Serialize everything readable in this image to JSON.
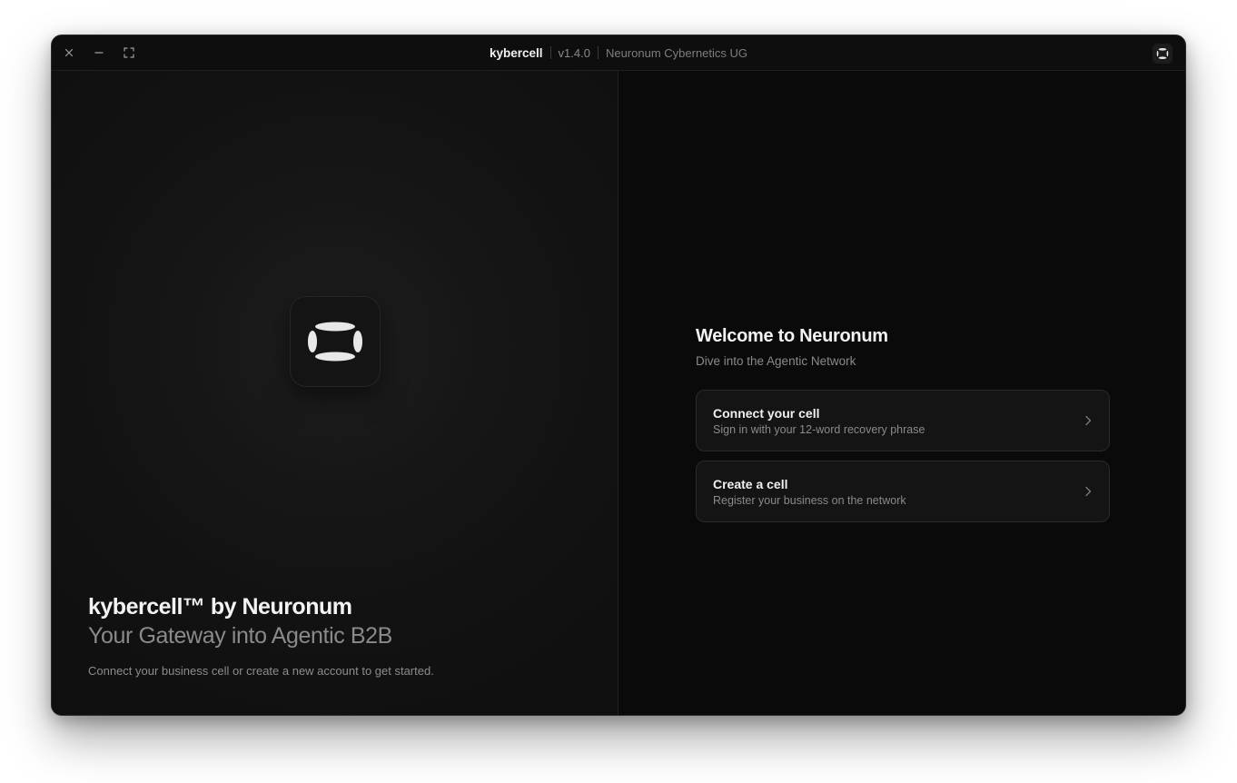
{
  "titlebar": {
    "app_name": "kybercell",
    "version": "v1.4.0",
    "company": "Neuronum Cybernetics UG",
    "controls": [
      "close-icon",
      "minimize-icon",
      "fullscreen-icon"
    ]
  },
  "hero": {
    "title": "kybercell™ by Neuronum",
    "subtitle": "Your Gateway into Agentic B2B",
    "text": "Connect your business cell or create a new account to get started."
  },
  "welcome": {
    "title": "Welcome to Neuronum",
    "subtitle": "Dive into the Agentic Network"
  },
  "options": [
    {
      "title": "Connect your cell",
      "description": "Sign in with your 12-word recovery phrase",
      "icon": "chevron-right-icon"
    },
    {
      "title": "Create a cell",
      "description": "Register your business on the network",
      "icon": "chevron-right-icon"
    }
  ],
  "colors": {
    "background": "#0b0b0b",
    "card": "#141414",
    "text_primary": "#f3f3f3",
    "text_secondary": "#8a8a8a",
    "logo": "#e8e8e8"
  }
}
